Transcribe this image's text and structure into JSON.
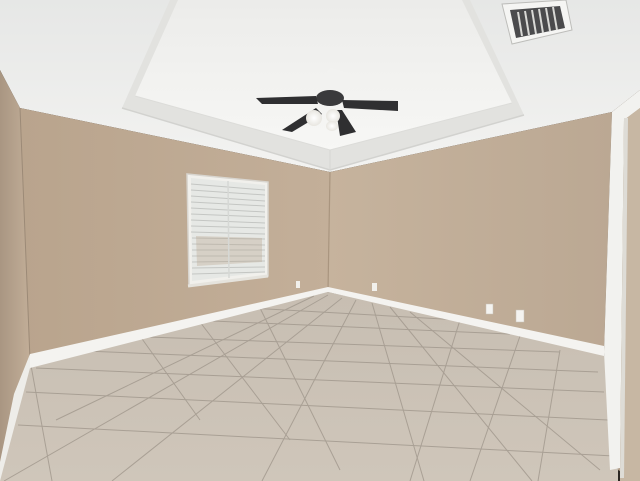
{
  "scene": {
    "description_free": true,
    "colors": {
      "wall_left": "#b8a38c",
      "wall_back_left": "#bda894",
      "wall_back_right": "#c4b09a",
      "wall_right": "#b9a690",
      "ceiling": "#ebebe9",
      "tray_ceiling": "#f2f2f0",
      "baseboard": "#f4f3f0",
      "floor": "#c9c0b4",
      "grout": "#9e958a",
      "window_blind": "#e9ebe8",
      "fan_blade": "#3a3a3c",
      "door_trim": "#f2f2ef"
    },
    "fan_light_on": true,
    "window_blinds_open": true
  }
}
